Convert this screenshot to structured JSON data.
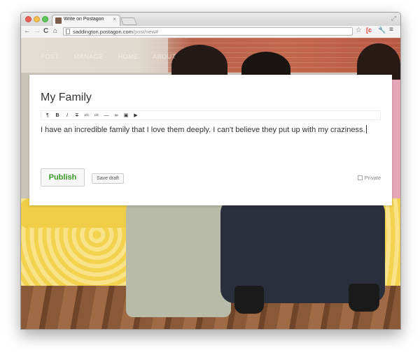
{
  "browser": {
    "tab_title": "Write on Postagon",
    "tab_close": "×",
    "url_host": "saddington.postagon.com",
    "url_path": "/post/new#",
    "toolbar_icons": [
      "back-arrow-icon",
      "forward-arrow-icon",
      "reload-icon",
      "home-icon",
      "star-icon",
      "extension-icon",
      "wrench-icon",
      "menu-icon"
    ]
  },
  "site_nav": [
    "POST",
    "MANAGE",
    "HOME",
    "ABOUT"
  ],
  "editor": {
    "title": "My Family",
    "format_buttons": [
      "¶",
      "B",
      "I",
      "T",
      "≔",
      "≔",
      "—",
      "∞",
      "▣",
      "▶"
    ],
    "body": "I have an incredible family that I love them deeply. I can't believe they put up with my craziness.",
    "publish_label": "Publish",
    "save_draft_label": "Save draft",
    "private_label": "Private"
  },
  "colors": {
    "publish_text": "#3a9a27",
    "background": "#ffffff"
  }
}
